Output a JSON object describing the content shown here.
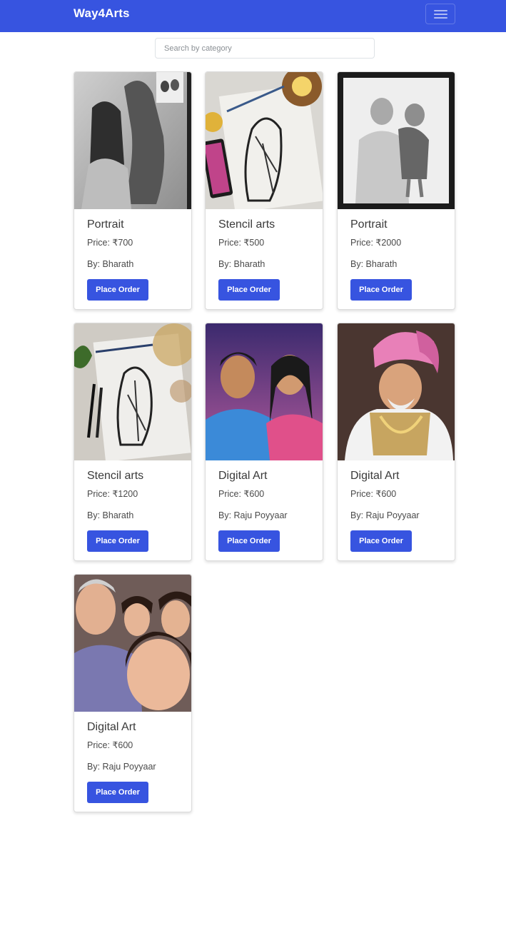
{
  "navbar": {
    "brand": "Way4Arts",
    "menu_icon": "hamburger-menu-icon",
    "color": "#3754e0"
  },
  "search": {
    "placeholder": "Search by category",
    "value": ""
  },
  "cards": [
    {
      "title": "Portrait",
      "price": "Price: ₹700",
      "author": "By: Bharath",
      "button": "Place Order",
      "image": "pencil portrait of woman with horse"
    },
    {
      "title": "Stencil arts",
      "price": "Price: ₹500",
      "author": "By: Bharath",
      "button": "Place Order",
      "image": "stencil drawing of couple with phone reference"
    },
    {
      "title": "Portrait",
      "price": "Price: ₹2000",
      "author": "By: Bharath",
      "button": "Place Order",
      "image": "pencil portrait of grandfather holding child"
    },
    {
      "title": "Stencil arts",
      "price": "Price: ₹1200",
      "author": "By: Bharath",
      "button": "Place Order",
      "image": "stencil drawing of family with pens"
    },
    {
      "title": "Digital Art",
      "price": "Price: ₹600",
      "author": "By: Raju Poyyaar",
      "button": "Place Order",
      "image": "digital painting of smiling couple"
    },
    {
      "title": "Digital Art",
      "price": "Price: ₹600",
      "author": "By: Raju Poyyaar",
      "button": "Place Order",
      "image": "digital painting of elder man in pink turban"
    },
    {
      "title": "Digital Art",
      "price": "Price: ₹600",
      "author": "By: Raju Poyyaar",
      "button": "Place Order",
      "image": "digital painting of family selfie"
    }
  ]
}
